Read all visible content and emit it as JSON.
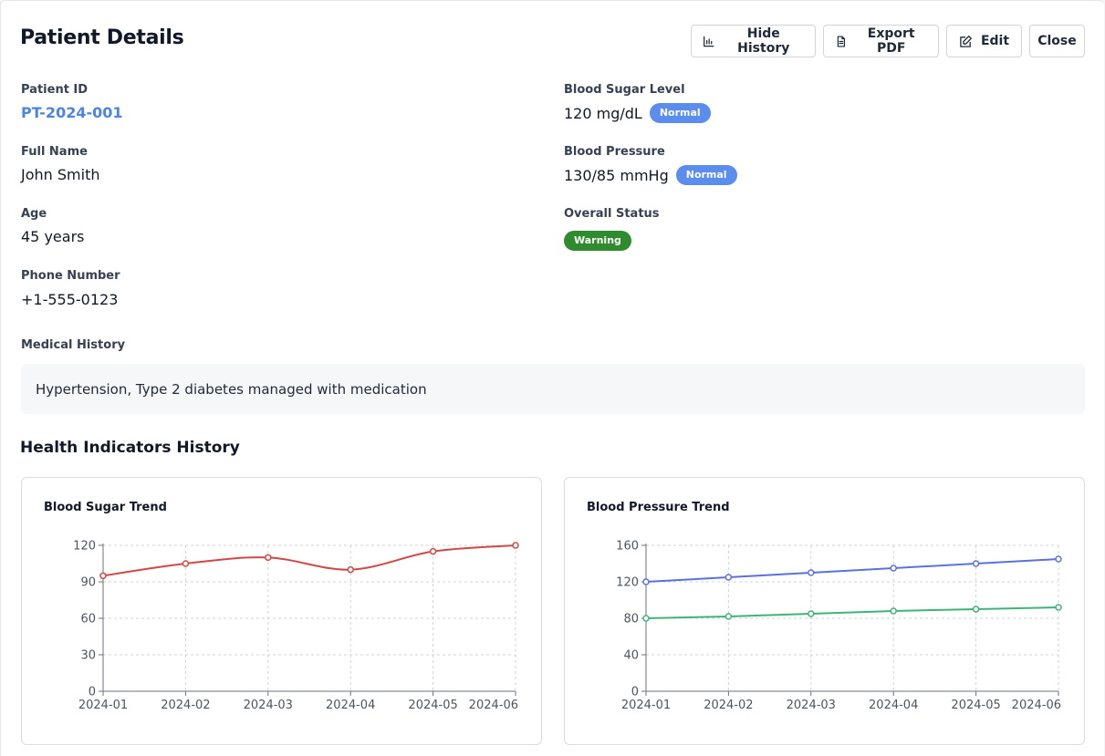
{
  "header": {
    "title": "Patient Details",
    "buttons": {
      "hide_history": "Hide History",
      "export_pdf": "Export PDF",
      "edit": "Edit",
      "close": "Close"
    }
  },
  "patient": {
    "id_label": "Patient ID",
    "id_value": "PT-2024-001",
    "name_label": "Full Name",
    "name_value": "John Smith",
    "age_label": "Age",
    "age_value": "45 years",
    "phone_label": "Phone Number",
    "phone_value": "+1-555-0123",
    "sugar_label": "Blood Sugar Level",
    "sugar_value": "120 mg/dL",
    "sugar_badge": "Normal",
    "bp_label": "Blood Pressure",
    "bp_value": "130/85 mmHg",
    "bp_badge": "Normal",
    "status_label": "Overall Status",
    "status_badge": "Warning",
    "history_label": "Medical History",
    "history_value": "Hypertension, Type 2 diabetes managed with medication"
  },
  "colors": {
    "badge_normal": "#5b8def",
    "badge_warning": "#2e8b2e",
    "sugar_line": "#d04848",
    "bp_systolic": "#5a72dc",
    "bp_diastolic": "#3fb37a"
  },
  "history_section": {
    "title": "Health Indicators History"
  },
  "chart_data": [
    {
      "type": "line",
      "title": "Blood Sugar Trend",
      "x": [
        "2024-01",
        "2024-02",
        "2024-03",
        "2024-04",
        "2024-05",
        "2024-06"
      ],
      "series": [
        {
          "values": [
            95,
            105,
            110,
            100,
            115,
            120
          ],
          "color": "#d04848"
        }
      ],
      "ylim": [
        0,
        120
      ],
      "yticks": [
        0,
        30,
        60,
        90,
        120
      ],
      "grid": true,
      "curve": "smooth"
    },
    {
      "type": "line",
      "title": "Blood Pressure Trend",
      "x": [
        "2024-01",
        "2024-02",
        "2024-03",
        "2024-04",
        "2024-05",
        "2024-06"
      ],
      "series": [
        {
          "values": [
            120,
            125,
            130,
            135,
            140,
            145
          ],
          "color": "#5a72dc"
        },
        {
          "values": [
            80,
            82,
            85,
            88,
            90,
            92
          ],
          "color": "#3fb37a"
        }
      ],
      "ylim": [
        0,
        160
      ],
      "yticks": [
        0,
        40,
        80,
        120,
        160
      ],
      "grid": true,
      "curve": "linear"
    }
  ]
}
